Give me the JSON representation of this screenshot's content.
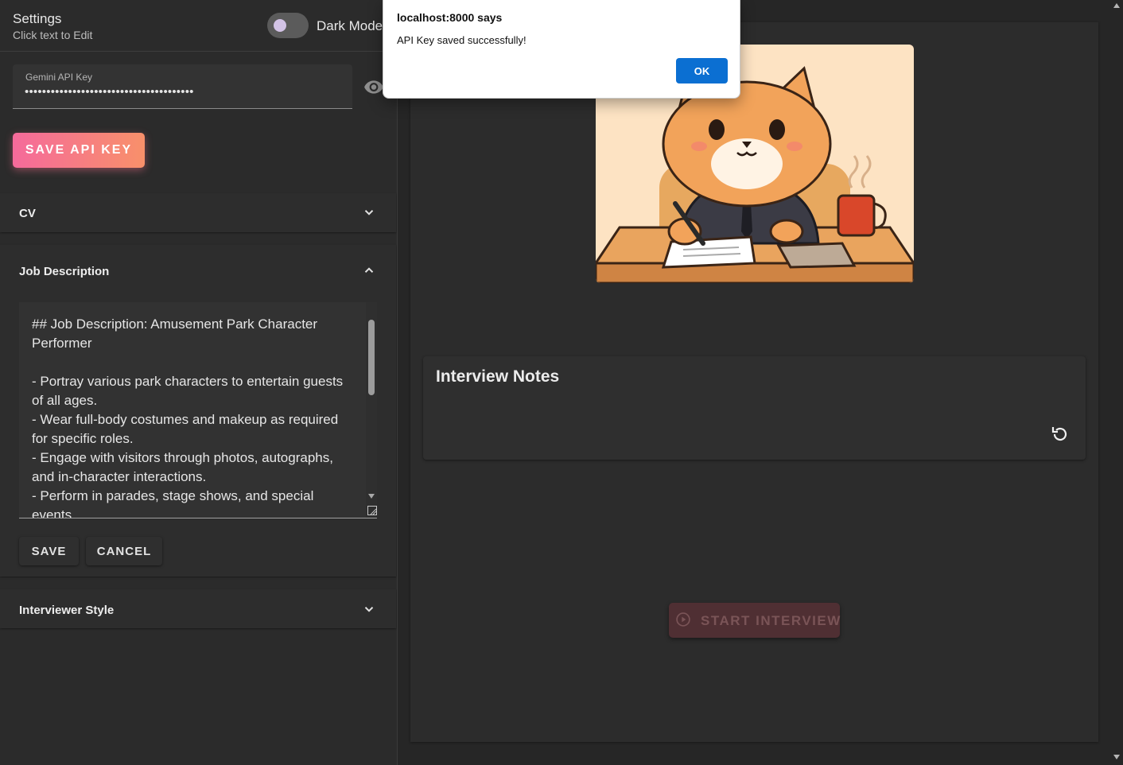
{
  "sidebar": {
    "title": "Settings",
    "subtitle": "Click text to Edit",
    "dark_mode_label": "Dark Mode",
    "api_key": {
      "label": "Gemini API Key",
      "value": "•••••••••••••••••••••••••••••••••••••••"
    },
    "save_api_label": "SAVE API KEY",
    "sections": {
      "cv": "CV",
      "job_description": "Job Description",
      "interviewer_style": "Interviewer Style"
    },
    "job_description_text": "## Job Description: Amusement Park Character Performer\n\n- Portray various park characters to entertain guests of all ages.\n- Wear full-body costumes and makeup as required for specific roles.\n- Engage with visitors through photos, autographs, and in-character interactions.\n- Perform in parades, stage shows, and special events.",
    "save_label": "SAVE",
    "cancel_label": "CANCEL"
  },
  "main": {
    "notes_title": "Interview Notes",
    "start_label": "START INTERVIEW"
  },
  "alert": {
    "title": "localhost:8000 says",
    "message": "API Key saved successfully!",
    "ok_label": "OK"
  },
  "colors": {
    "accent_start": "#f56a9b",
    "accent_end": "#f8906a",
    "dialog_button": "#0b6fd2"
  }
}
